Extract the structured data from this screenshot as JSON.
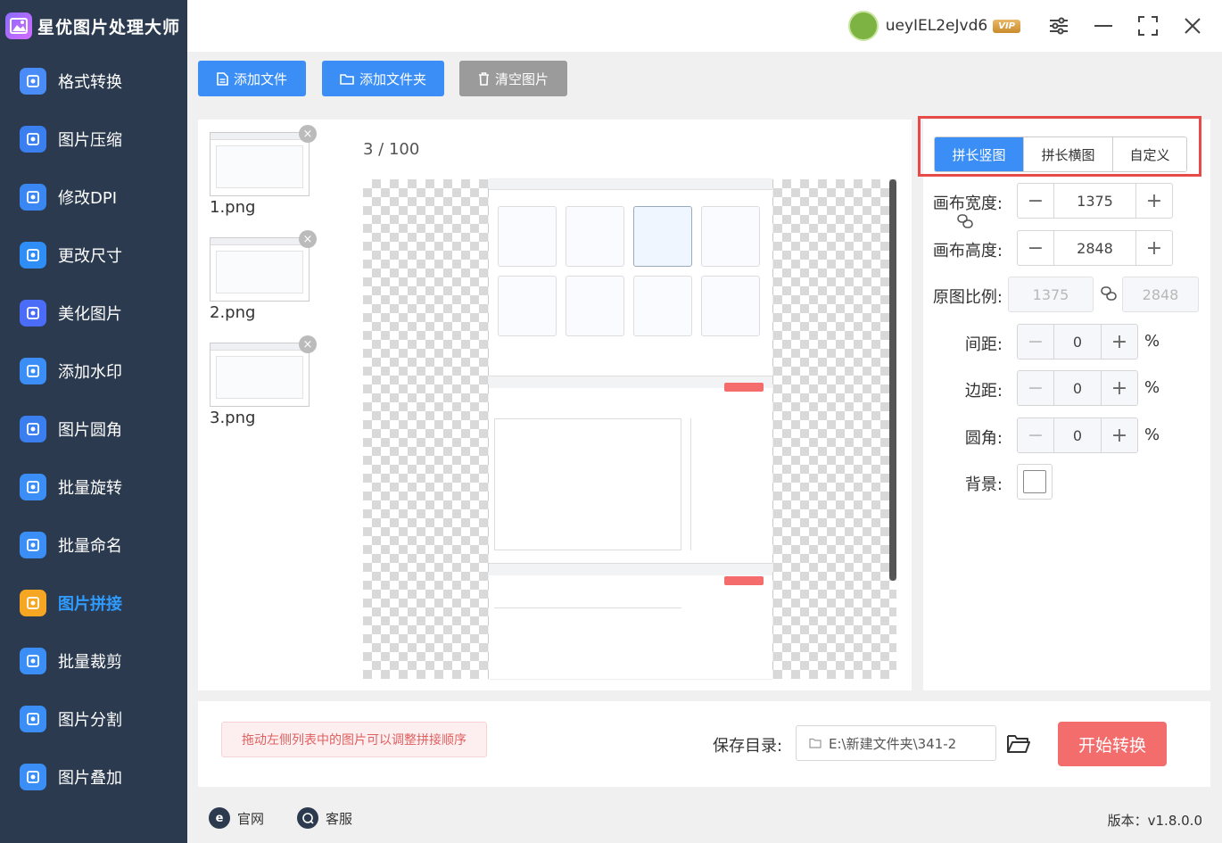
{
  "app": {
    "title": "星优图片处理大师"
  },
  "user": {
    "name": "ueyIEL2eJvd6",
    "badge": "VIP"
  },
  "sidebar": {
    "items": [
      {
        "label": "格式转换",
        "icon": "image-convert-icon",
        "color": "#4a8cf7"
      },
      {
        "label": "图片压缩",
        "icon": "compress-icon",
        "color": "#3a7ef0"
      },
      {
        "label": "修改DPI",
        "icon": "dpi-icon",
        "color": "#3a86f2"
      },
      {
        "label": "更改尺寸",
        "icon": "resize-icon",
        "color": "#2f8ef5"
      },
      {
        "label": "美化图片",
        "icon": "beautify-icon",
        "color": "#4a6cf7"
      },
      {
        "label": "添加水印",
        "icon": "watermark-icon",
        "color": "#3a8ef6"
      },
      {
        "label": "图片圆角",
        "icon": "round-corner-icon",
        "color": "#3a7ef0"
      },
      {
        "label": "批量旋转",
        "icon": "rotate-icon",
        "color": "#3a8ef6"
      },
      {
        "label": "批量命名",
        "icon": "rename-icon",
        "color": "#3a8ef6"
      },
      {
        "label": "图片拼接",
        "icon": "puzzle-icon",
        "color": "#f5a623",
        "active": true
      },
      {
        "label": "批量裁剪",
        "icon": "crop-icon",
        "color": "#3a8ef6"
      },
      {
        "label": "图片分割",
        "icon": "split-icon",
        "color": "#3a8ef6"
      },
      {
        "label": "图片叠加",
        "icon": "layers-icon",
        "color": "#3a8ef6"
      }
    ]
  },
  "toolbar": {
    "add_file": "添加文件",
    "add_folder": "添加文件夹",
    "clear": "清空图片"
  },
  "files": [
    {
      "name": "1.png"
    },
    {
      "name": "2.png"
    },
    {
      "name": "3.png"
    }
  ],
  "preview": {
    "counter": "3 / 100"
  },
  "settings": {
    "tabs": [
      "拼长竖图",
      "拼长横图",
      "自定义"
    ],
    "active_tab": "拼长竖图",
    "canvas_width_label": "画布宽度:",
    "canvas_width": "1375",
    "canvas_height_label": "画布高度:",
    "canvas_height": "2848",
    "ratio_label": "原图比例:",
    "ratio_w": "1375",
    "ratio_h": "2848",
    "spacing_label": "间距:",
    "spacing": "0",
    "margin_label": "边距:",
    "margin": "0",
    "radius_label": "圆角:",
    "radius": "0",
    "percent": "%",
    "bg_label": "背景:"
  },
  "bottom": {
    "hint": "拖动左侧列表中的图片可以调整拼接顺序",
    "save_label": "保存目录:",
    "save_path": "E:\\新建文件夹\\341-2",
    "start": "开始转换"
  },
  "footer": {
    "website": "官网",
    "support": "客服",
    "version": "版本：v1.8.0.0"
  }
}
